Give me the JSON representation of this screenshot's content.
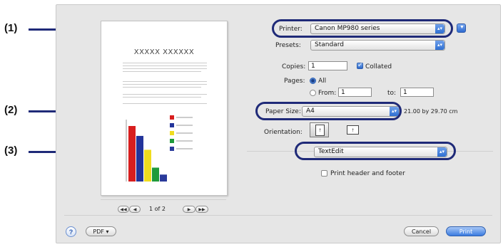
{
  "callouts": [
    "(1)",
    "(2)",
    "(3)"
  ],
  "printer": {
    "label": "Printer:",
    "value": "Canon MP980 series"
  },
  "presets": {
    "label": "Presets:",
    "value": "Standard"
  },
  "copies": {
    "label": "Copies:",
    "value": "1",
    "collated_label": "Collated",
    "collated": true
  },
  "pages": {
    "label": "Pages:",
    "all_label": "All",
    "from_label": "From:",
    "from_value": "1",
    "to_label": "to:",
    "to_value": "1"
  },
  "paper_size": {
    "label": "Paper Size:",
    "value": "A4",
    "dimensions": "21.00 by 29.70 cm"
  },
  "orientation": {
    "label": "Orientation:"
  },
  "app_popup": {
    "value": "TextEdit"
  },
  "print_header": {
    "label": "Print header and footer",
    "checked": false
  },
  "preview": {
    "title": "XXXXX XXXXXX",
    "page_indicator": "1 of 2"
  },
  "preview_chart": {
    "type": "bar",
    "values": [
      56,
      46,
      32,
      14,
      7
    ],
    "colors": [
      "#d81e1e",
      "#23349a",
      "#f0dc1e",
      "#1f9a3a",
      "#2a3a9a"
    ]
  },
  "bottom": {
    "help": "?",
    "pdf_label": "PDF ▾",
    "cancel_label": "Cancel",
    "print_label": "Print"
  },
  "nav": {
    "first": "◀◀",
    "prev": "◀",
    "next": "▶",
    "last": "▶▶"
  },
  "colors": {
    "ring": "#1f2a78",
    "accent": "#3a7be0"
  }
}
